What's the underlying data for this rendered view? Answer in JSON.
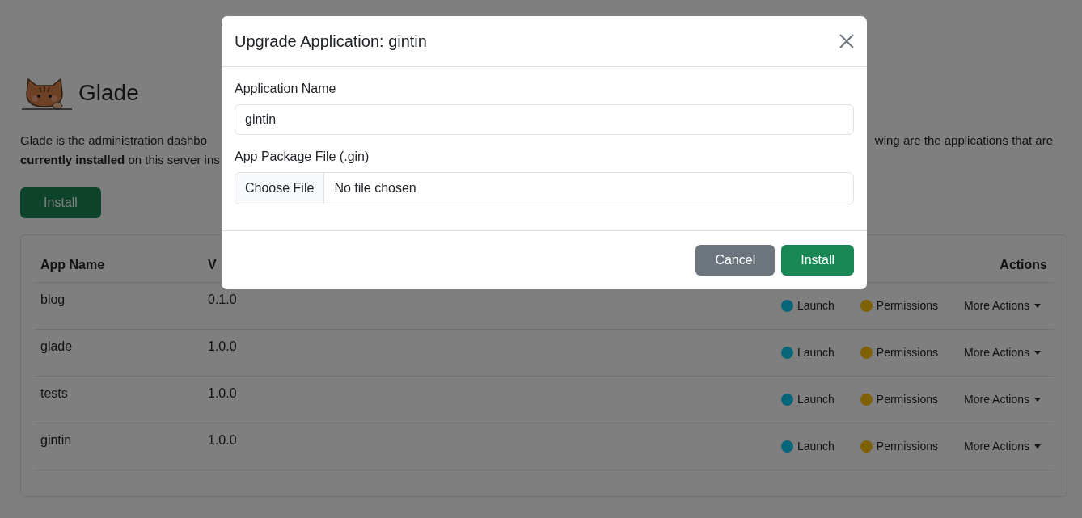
{
  "page": {
    "title": "Glade",
    "intro_line_1_start": "Glade is the administration dashbo",
    "intro_line_1_end": "wing are the applications that are",
    "intro_line_2": "**currently installed** on this server ins",
    "install_button": "Install"
  },
  "table": {
    "columns": [
      "App Name",
      "V",
      "Actions"
    ],
    "rows": [
      {
        "name": "blog",
        "version": "0.1.0",
        "launch": "Launch",
        "permissions": "Permissions",
        "more": "More Actions"
      },
      {
        "name": "glade",
        "version": "1.0.0",
        "launch": "Launch",
        "permissions": "Permissions",
        "more": "More Actions"
      },
      {
        "name": "tests",
        "version": "1.0.0",
        "launch": "Launch",
        "permissions": "Permissions",
        "more": "More Actions"
      },
      {
        "name": "gintin",
        "version": "1.0.0",
        "launch": "Launch",
        "permissions": "Permissions",
        "more": "More Actions"
      }
    ]
  },
  "modal": {
    "title": "Upgrade Application: gintin",
    "name_label": "Application Name",
    "name_value": "gintin",
    "file_label": "App Package File (.gin)",
    "choose_button": "Choose File",
    "file_status": "No file chosen",
    "cancel_button": "Cancel",
    "install_button": "Install"
  }
}
